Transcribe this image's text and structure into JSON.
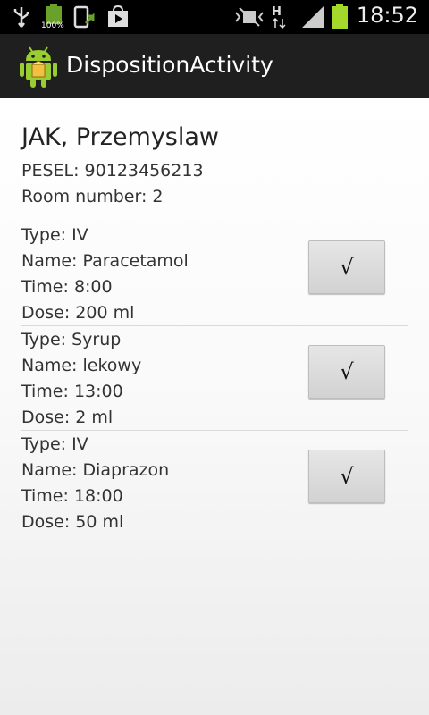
{
  "status_bar": {
    "time": "18:52",
    "battery_small_label": "100%",
    "signal_label": "H"
  },
  "action_bar": {
    "title": "DispositionActivity"
  },
  "patient": {
    "name": "JAK, Przemyslaw",
    "pesel": "PESEL: 90123456213",
    "room": "Room number: 2"
  },
  "medications": [
    {
      "type": "Type: IV",
      "name": "Name: Paracetamol",
      "time": "Time: 8:00",
      "dose": "Dose: 200 ml",
      "button_label": "√"
    },
    {
      "type": "Type: Syrup",
      "name": "Name: lekowy",
      "time": "Time: 13:00",
      "dose": "Dose: 2 ml",
      "button_label": "√"
    },
    {
      "type": "Type: IV",
      "name": "Name: Diaprazon",
      "time": "Time: 18:00",
      "dose": "Dose: 50 ml",
      "button_label": "√"
    }
  ]
}
